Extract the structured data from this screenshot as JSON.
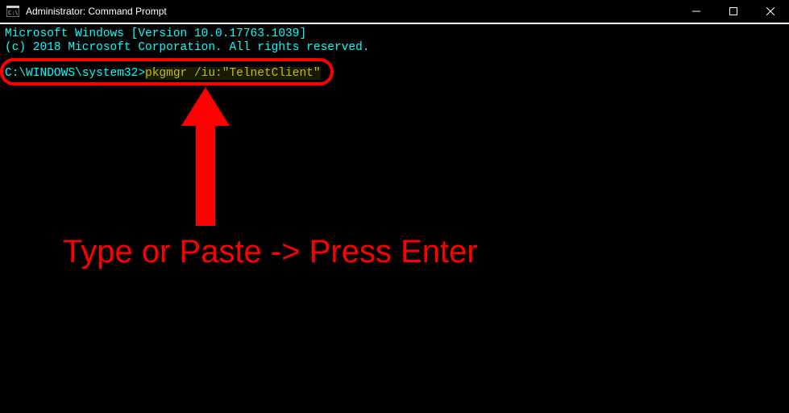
{
  "window": {
    "title": "Administrator: Command Prompt"
  },
  "terminal": {
    "line1": "Microsoft Windows [Version 10.0.17763.1039]",
    "line2": "(c) 2018 Microsoft Corporation. All rights reserved.",
    "prompt_path": "C:\\WINDOWS\\system32>",
    "prompt_cmd": "pkgmgr /iu:\"TelnetClient\""
  },
  "annotation": {
    "text": "Type or Paste -> Press Enter"
  }
}
